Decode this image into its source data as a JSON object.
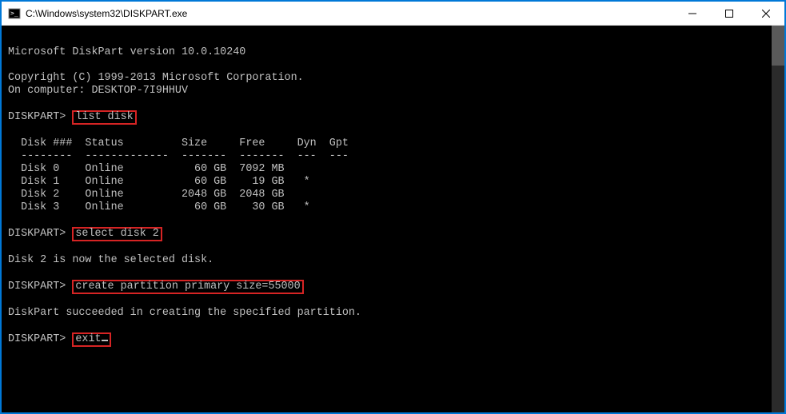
{
  "titlebar": {
    "title": "C:\\Windows\\system32\\DISKPART.exe"
  },
  "terminal": {
    "version_line": "Microsoft DiskPart version 10.0.10240",
    "copyright_line": "Copyright (C) 1999-2013 Microsoft Corporation.",
    "computer_line": "On computer: DESKTOP-7I9HHUV",
    "prompt": "DISKPART>",
    "cmd_list_disk": "list disk",
    "table_header": "  Disk ###  Status         Size     Free     Dyn  Gpt",
    "table_divider": "  --------  -------------  -------  -------  ---  ---",
    "table_rows": [
      "  Disk 0    Online           60 GB  7092 MB",
      "  Disk 1    Online           60 GB    19 GB   *",
      "  Disk 2    Online         2048 GB  2048 GB",
      "  Disk 3    Online           60 GB    30 GB   *"
    ],
    "cmd_select_disk": "select disk 2",
    "select_result": "Disk 2 is now the selected disk.",
    "cmd_create_partition": "create partition primary size=55000",
    "create_result": "DiskPart succeeded in creating the specified partition.",
    "cmd_exit": "exit"
  },
  "chart_data": {
    "type": "table",
    "title": "list disk",
    "columns": [
      "Disk ###",
      "Status",
      "Size",
      "Free",
      "Dyn",
      "Gpt"
    ],
    "rows": [
      {
        "Disk ###": "Disk 0",
        "Status": "Online",
        "Size": "60 GB",
        "Free": "7092 MB",
        "Dyn": "",
        "Gpt": ""
      },
      {
        "Disk ###": "Disk 1",
        "Status": "Online",
        "Size": "60 GB",
        "Free": "19 GB",
        "Dyn": "*",
        "Gpt": ""
      },
      {
        "Disk ###": "Disk 2",
        "Status": "Online",
        "Size": "2048 GB",
        "Free": "2048 GB",
        "Dyn": "",
        "Gpt": ""
      },
      {
        "Disk ###": "Disk 3",
        "Status": "Online",
        "Size": "60 GB",
        "Free": "30 GB",
        "Dyn": "*",
        "Gpt": ""
      }
    ]
  }
}
